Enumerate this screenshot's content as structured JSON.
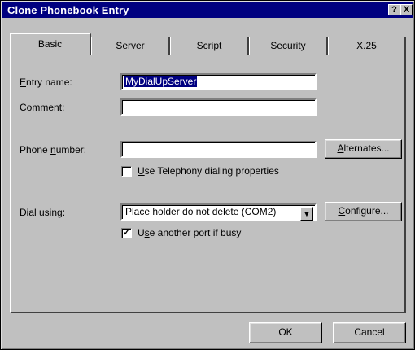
{
  "window": {
    "title": "Clone Phonebook Entry",
    "help_label": "?",
    "close_label": "X"
  },
  "tabs": [
    {
      "label": "Basic",
      "selected": true
    },
    {
      "label": "Server",
      "selected": false
    },
    {
      "label": "Script",
      "selected": false
    },
    {
      "label": "Security",
      "selected": false
    },
    {
      "label": "X.25",
      "selected": false
    }
  ],
  "form": {
    "entry_name": {
      "label_key": "E",
      "label_rest": "ntry name:",
      "value": "MyDialUpServer"
    },
    "comment": {
      "label_pre": "Co",
      "label_key": "m",
      "label_rest": "ment:",
      "value": ""
    },
    "phone_number": {
      "label_pre": "Phone ",
      "label_key": "n",
      "label_rest": "umber:",
      "value": ""
    },
    "alternates": {
      "label_key": "A",
      "label_rest": "lternates..."
    },
    "telephony": {
      "checked": false,
      "label_key": "U",
      "label_rest": "se Telephony dialing properties"
    },
    "dial_using": {
      "label_key": "D",
      "label_rest": "ial using:",
      "value": "Place holder do not delete (COM2)"
    },
    "configure": {
      "label_key": "C",
      "label_rest": "onfigure..."
    },
    "another_port": {
      "checked": true,
      "label_pre": "U",
      "label_key": "s",
      "label_rest": "e another port if busy"
    }
  },
  "buttons": {
    "ok": "OK",
    "cancel": "Cancel"
  }
}
